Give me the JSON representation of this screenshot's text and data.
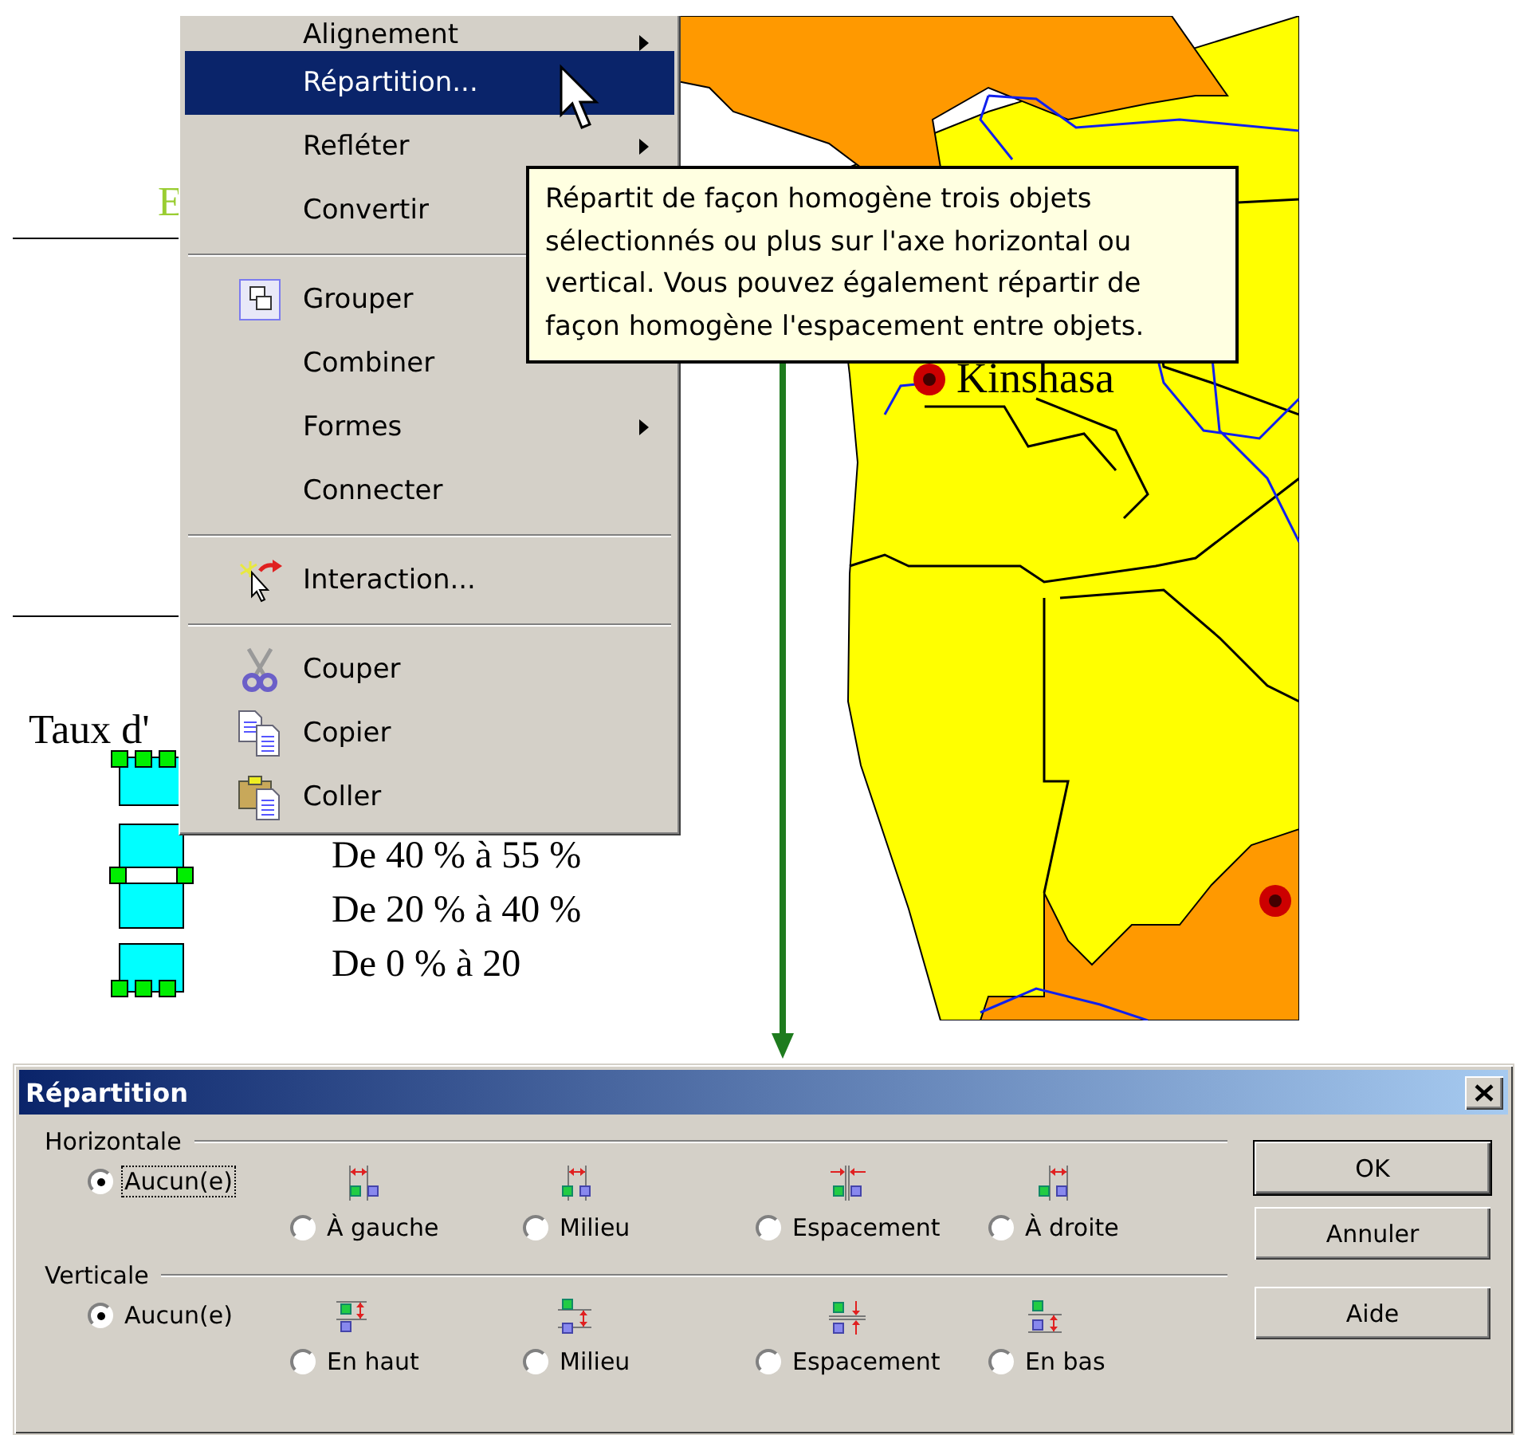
{
  "document": {
    "heading_fragment": "E",
    "legend_title": "Taux d'",
    "legend_items": [
      "De 40 % à 55 %",
      "De 20 % à 40 %",
      "De 0 % à 20"
    ],
    "map_labels": [
      "Kinshasa"
    ]
  },
  "context_menu": {
    "items": [
      {
        "kind": "item",
        "label": "Alignement",
        "submenu": true,
        "selected": false
      },
      {
        "kind": "item",
        "label": "Répartition...",
        "submenu": false,
        "selected": true
      },
      {
        "kind": "item",
        "label": "Refléter",
        "submenu": true,
        "selected": false
      },
      {
        "kind": "item",
        "label": "Convertir",
        "submenu": false,
        "selected": false
      },
      {
        "kind": "separator"
      },
      {
        "kind": "item",
        "label": "Grouper",
        "submenu": false,
        "selected": false
      },
      {
        "kind": "item",
        "label": "Combiner",
        "submenu": false,
        "selected": false
      },
      {
        "kind": "item",
        "label": "Formes",
        "submenu": true,
        "selected": false
      },
      {
        "kind": "item",
        "label": "Connecter",
        "submenu": false,
        "selected": false
      },
      {
        "kind": "separator"
      },
      {
        "kind": "item",
        "label": "Interaction...",
        "submenu": false,
        "selected": false
      },
      {
        "kind": "separator"
      },
      {
        "kind": "item",
        "label": "Couper",
        "submenu": false,
        "selected": false
      },
      {
        "kind": "item",
        "label": "Copier",
        "submenu": false,
        "selected": false
      },
      {
        "kind": "item",
        "label": "Coller",
        "submenu": false,
        "selected": false
      }
    ]
  },
  "tooltip": {
    "text": "Répartit de façon homogène trois objets sélectionnés ou plus sur l'axe horizontal ou vertical. Vous pouvez également répartir de façon homogène l'espacement entre objets."
  },
  "dialog": {
    "title": "Répartition",
    "groups": [
      {
        "label": "Horizontale",
        "options": [
          {
            "kind": "plain",
            "label": "Aucun(e)",
            "selected": true,
            "focused": true
          },
          {
            "kind": "pictured",
            "label": "À gauche",
            "selected": false,
            "focused": false
          },
          {
            "kind": "pictured",
            "label": "Milieu",
            "selected": false,
            "focused": false
          },
          {
            "kind": "pictured",
            "label": "Espacement",
            "selected": false,
            "focused": false
          },
          {
            "kind": "pictured",
            "label": "À droite",
            "selected": false,
            "focused": false
          }
        ]
      },
      {
        "label": "Verticale",
        "options": [
          {
            "kind": "plain",
            "label": "Aucun(e)",
            "selected": true,
            "focused": false
          },
          {
            "kind": "pictured",
            "label": "En haut",
            "selected": false,
            "focused": false
          },
          {
            "kind": "pictured",
            "label": "Milieu",
            "selected": false,
            "focused": false
          },
          {
            "kind": "pictured",
            "label": "Espacement",
            "selected": false,
            "focused": false
          },
          {
            "kind": "pictured",
            "label": "En bas",
            "selected": false,
            "focused": false
          }
        ]
      }
    ],
    "buttons": [
      {
        "label": "OK",
        "default": true
      },
      {
        "label": "Annuler",
        "default": false
      },
      {
        "label": "Aide",
        "default": false
      }
    ]
  }
}
